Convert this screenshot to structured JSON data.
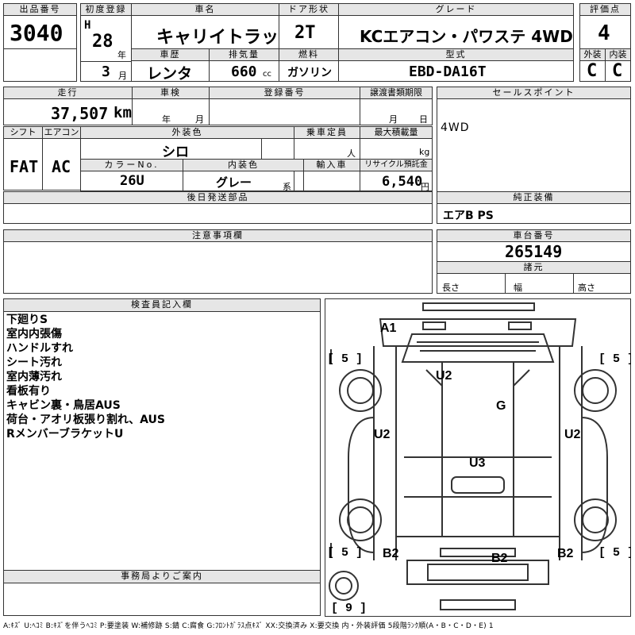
{
  "header": {
    "lot_no": {
      "label": "出品番号",
      "value": "3040"
    },
    "first_reg": {
      "label": "初度登録",
      "era": "H",
      "year": "28",
      "year_unit": "年",
      "month": "3",
      "month_unit": "月"
    },
    "car_name": {
      "label": "車名",
      "value": "キャリイトラック"
    },
    "door": {
      "label": "ドア形状",
      "value": "2T"
    },
    "grade": {
      "label": "グレード",
      "value": "KCエアコン・パワステ 4WD"
    },
    "score": {
      "label": "評価点",
      "value": "4"
    },
    "history": {
      "label": "車歴",
      "value": "レンタ"
    },
    "displacement": {
      "label": "排気量",
      "value": "660",
      "unit": "cc"
    },
    "fuel": {
      "label": "燃料",
      "value": "ガソリン"
    },
    "model_code": {
      "label": "型式",
      "value": "EBD-DA16T"
    },
    "exterior": {
      "label": "外装",
      "value": "C"
    },
    "interior": {
      "label": "内装",
      "value": "C"
    }
  },
  "details": {
    "mileage": {
      "label": "走行",
      "value": "37,507",
      "unit": "km"
    },
    "inspection": {
      "label": "車検",
      "year_unit": "年",
      "month_unit": "月"
    },
    "reg_no": {
      "label": "登録番号"
    },
    "transfer_deadline": {
      "label": "譲渡書類期限",
      "month_unit": "月",
      "day_unit": "日"
    },
    "shift": {
      "label": "シフト",
      "value": "FAT"
    },
    "aircon": {
      "label": "エアコン",
      "value": "AC"
    },
    "ext_color": {
      "label": "外装色",
      "value": "シロ"
    },
    "capacity": {
      "label": "乗車定員",
      "unit": "人"
    },
    "max_load": {
      "label": "最大積載量",
      "unit": "kg"
    },
    "color_no": {
      "label": "カラーNo.",
      "value": "26U"
    },
    "int_color": {
      "label": "内装色",
      "value": "グレー",
      "suffix": "系"
    },
    "import": {
      "label": "輸入車"
    },
    "recycle": {
      "label": "リサイクル預託金",
      "value": "6,540",
      "unit": "円"
    },
    "later_parts": {
      "label": "後日発送部品"
    },
    "cautions": {
      "label": "注意事項欄"
    }
  },
  "right_panel": {
    "sales_point": {
      "label": "セールスポイント",
      "value": "4WD"
    },
    "equipment": {
      "label": "純正装備",
      "value": "エアB PS"
    },
    "chassis_no": {
      "label": "車台番号",
      "value": "265149"
    },
    "specs": {
      "label": "諸元",
      "length": "長さ",
      "width": "幅",
      "height": "高さ"
    }
  },
  "inspector": {
    "label": "検査員記入欄",
    "lines": [
      "下廻りS",
      "室内内張傷",
      "ハンドルすれ",
      "シート汚れ",
      "室内薄汚れ",
      "看板有り",
      "キャビン裏・鳥居AUS",
      "荷台・アオリ板張り割れ、AUS",
      "RメンバーブラケットU"
    ]
  },
  "office": {
    "label": "事務局よりご案内"
  },
  "diagram": {
    "marks": {
      "a1": "A1",
      "u2_top": "U2",
      "g": "G",
      "u2_left": "U2",
      "u2_right": "U2",
      "u3": "U3",
      "b2_left": "B2",
      "b2_mid": "B2",
      "b2_right": "B2"
    },
    "tires": {
      "fl": "[ 5 ]",
      "fr": "[ 5 ]",
      "rl": "[ 5 ]",
      "rr": "[ 5 ]",
      "spare": "[ 9 ]"
    }
  },
  "legend": "A:ｷｽﾞ U:ﾍｺﾐ B:ｷｽﾞを伴うﾍｺﾐ P:要塗装 W:補修跡 S:錆 C:腐食 G:ﾌﾛﾝﾄｶﾞﾗｽ点ｷｽﾞ XX:交換済み X:要交換  内・外装評価 5段階ﾗﾝｸ順(A・B・C・D・E) 1"
}
